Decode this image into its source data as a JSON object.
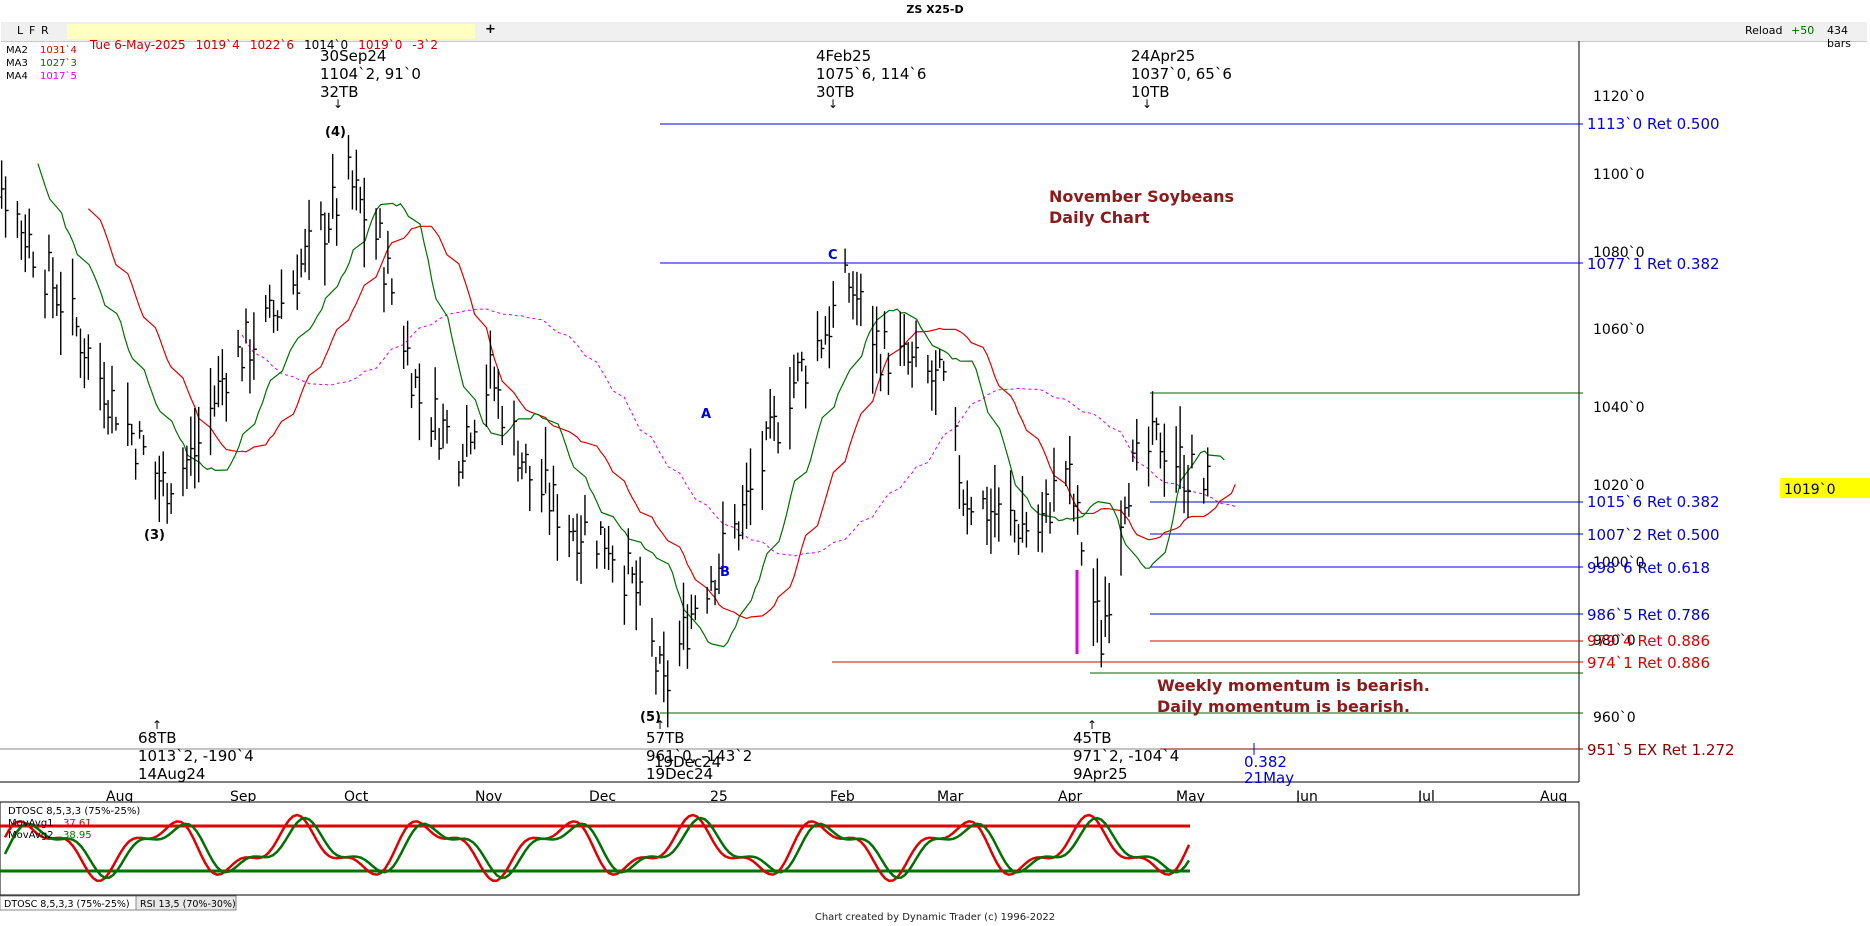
{
  "header": {
    "title": "ZS X25-D",
    "toolbar_buttons": [
      "L",
      "F",
      "R"
    ],
    "quote": {
      "date": "Tue 6-May-2025",
      "open": "1019`4",
      "high": "1022`6",
      "low": "1014`0",
      "close": "1019`0",
      "change": "-3`2"
    },
    "add_label": "+",
    "reload_label": "Reload",
    "plus_label": "+50",
    "bars_label": "434 bars"
  },
  "ma_legend": {
    "ma2": {
      "label": "MA2",
      "value": "1031`4",
      "color": "#e00000"
    },
    "ma3": {
      "label": "MA3",
      "value": "1027`3",
      "color": "#007000"
    },
    "ma4": {
      "label": "MA4",
      "value": "1017`5",
      "color": "#e000e0"
    }
  },
  "annotations": {
    "top1": {
      "l1": "30Sep24",
      "l2": "1104`2, 91`0",
      "l3": "32TB"
    },
    "top2": {
      "l1": "4Feb25",
      "l2": "1075`6, 114`6",
      "l3": "30TB"
    },
    "top3": {
      "l1": "24Apr25",
      "l2": "1037`0, 65`6",
      "l3": "10TB"
    },
    "bot1": {
      "l1": "68TB",
      "l2": "1013`2, -190`4",
      "l3": "14Aug24"
    },
    "bot2": {
      "l1": "57TB",
      "l2": "961`0, -143`2",
      "l3": "19Dec24",
      "extra": "19Dec24"
    },
    "bot3": {
      "l1": "45TB",
      "l2": "971`2, -104`4",
      "l3": "9Apr25"
    },
    "waves": {
      "w3": "(3)",
      "w4": "(4)",
      "w5": "(5)",
      "A": "A",
      "B": "B",
      "C": "C"
    },
    "chart_title_1": "November Soybeans",
    "chart_title_2": "Daily Chart",
    "momentum_1": "Weekly momentum is bearish.",
    "momentum_2": "Daily momentum is bearish.",
    "time_target": {
      "ratio": "0.382",
      "date": "21May"
    }
  },
  "price_label": "1019`0",
  "retracements": [
    {
      "text": "1113`0 Ret 0.500",
      "color": "#0000dd"
    },
    {
      "text": "1077`1 Ret 0.382",
      "color": "#0000dd"
    },
    {
      "text": "1015`6 Ret 0.382",
      "color": "#0000dd"
    },
    {
      "text": "1007`2 Ret 0.500",
      "color": "#0000dd"
    },
    {
      "text": "998`6 Ret 0.618",
      "color": "#0000dd"
    },
    {
      "text": "986`5 Ret 0.786",
      "color": "#0000dd"
    },
    {
      "text": "979`4 Ret 0.886",
      "color": "#e00000"
    },
    {
      "text": "974`1 Ret 0.886",
      "color": "#e00000"
    },
    {
      "text": "951`5 EX Ret 1.272",
      "color": "#8b0000"
    }
  ],
  "osc": {
    "title": "DTOSC 8,5,3,3 (75%-25%)",
    "ma1_label": "MovAvg1",
    "ma1_value": "37.61",
    "ma2_label": "MovAvg2",
    "ma2_value": "38.95",
    "tab1": "DTOSC 8,5,3,3 (75%-25%)",
    "tab2": "RSI 13,5 (70%-30%)"
  },
  "footer": "Chart created by Dynamic Trader  (c)  1996-2022",
  "chart_data": {
    "type": "ohlc",
    "title": "November Soybeans Daily Chart",
    "ylim": [
      945,
      1130
    ],
    "y_ticks": [
      "960`0",
      "980`0",
      "1000`0",
      "1020`0",
      "1040`0",
      "1060`0",
      "1080`0",
      "1100`0",
      "1120`0"
    ],
    "y_tick_values": [
      960,
      980,
      1000,
      1020,
      1040,
      1060,
      1080,
      1100,
      1120
    ],
    "x_ticks": [
      "Aug",
      "Sep",
      "Oct",
      "Nov",
      "Dec",
      "25",
      "Feb",
      "Mar",
      "Apr",
      "May",
      "Jun",
      "Jul",
      "Aug"
    ],
    "x_tick_dates": [
      "2024-08-01",
      "2024-09-01",
      "2024-10-01",
      "2024-11-01",
      "2024-12-01",
      "2025-01-01",
      "2025-02-01",
      "2025-03-01",
      "2025-04-01",
      "2025-05-01",
      "2025-06-01",
      "2025-07-01",
      "2025-08-01"
    ],
    "price_path": [
      {
        "date": "2024-06-25",
        "close": 1116
      },
      {
        "date": "2024-07-10",
        "close": 1085
      },
      {
        "date": "2024-07-22",
        "close": 1062
      },
      {
        "date": "2024-08-01",
        "close": 1042
      },
      {
        "date": "2024-08-09",
        "close": 1028
      },
      {
        "date": "2024-08-14",
        "close": 1020
      },
      {
        "date": "2024-08-22",
        "close": 1028
      },
      {
        "date": "2024-08-30",
        "close": 1050
      },
      {
        "date": "2024-09-10",
        "close": 1062
      },
      {
        "date": "2024-09-20",
        "close": 1080
      },
      {
        "date": "2024-09-30",
        "close": 1098
      },
      {
        "date": "2024-10-08",
        "close": 1082
      },
      {
        "date": "2024-10-18",
        "close": 1042
      },
      {
        "date": "2024-10-28",
        "close": 1030
      },
      {
        "date": "2024-11-05",
        "close": 1048
      },
      {
        "date": "2024-11-15",
        "close": 1022
      },
      {
        "date": "2024-11-25",
        "close": 1010
      },
      {
        "date": "2024-12-05",
        "close": 1006
      },
      {
        "date": "2024-12-12",
        "close": 992
      },
      {
        "date": "2024-12-19",
        "close": 966
      },
      {
        "date": "2024-12-27",
        "close": 990
      },
      {
        "date": "2025-01-06",
        "close": 1008
      },
      {
        "date": "2025-01-13",
        "close": 1025
      },
      {
        "date": "2025-01-20",
        "close": 1045
      },
      {
        "date": "2025-01-28",
        "close": 1058
      },
      {
        "date": "2025-02-04",
        "close": 1072
      },
      {
        "date": "2025-02-12",
        "close": 1055
      },
      {
        "date": "2025-02-20",
        "close": 1050
      },
      {
        "date": "2025-02-28",
        "close": 1045
      },
      {
        "date": "2025-03-05",
        "close": 1018
      },
      {
        "date": "2025-03-14",
        "close": 1012
      },
      {
        "date": "2025-03-24",
        "close": 1008
      },
      {
        "date": "2025-03-31",
        "close": 1025
      },
      {
        "date": "2025-04-04",
        "close": 1005
      },
      {
        "date": "2025-04-09",
        "close": 980
      },
      {
        "date": "2025-04-15",
        "close": 1020
      },
      {
        "date": "2025-04-24",
        "close": 1032
      },
      {
        "date": "2025-04-30",
        "close": 1024
      },
      {
        "date": "2025-05-06",
        "close": 1019
      }
    ],
    "retracement_levels": [
      1113.0,
      1077.125,
      1015.75,
      1007.25,
      998.75,
      986.625,
      979.5,
      974.125,
      951.625
    ],
    "oscillator": {
      "upper": 75,
      "lower": 25,
      "ma1_last": 37.61,
      "ma2_last": 38.95
    }
  }
}
